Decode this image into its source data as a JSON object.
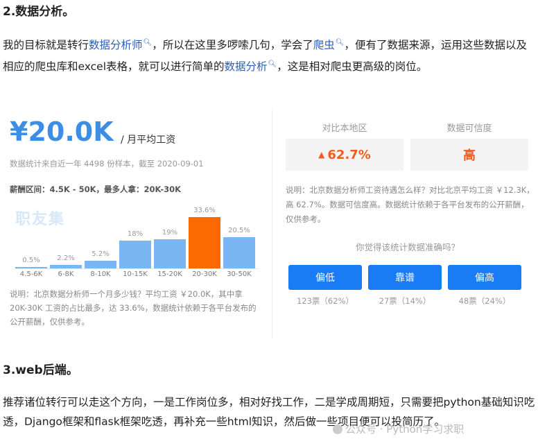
{
  "section2": {
    "title": "2.数据分析。",
    "p_part1": "我的目标就是转行",
    "p_link1": "数据分析师",
    "p_part2": "，所以在这里多啰嗦几句，学会了",
    "p_link2": "爬虫",
    "p_part3": "，便有了数据来源，运用这些数据以及相应的爬虫库和excel表格，就可以进行简单的",
    "p_link3": "数据分析",
    "p_part4": "，这是相对爬虫更高级的岗位。"
  },
  "salary_card": {
    "amount": "¥20.0K",
    "unit": "/ 月平均工资",
    "stats": "数据统计来自近一年 4498 份样本，截至 2020-09-01",
    "range": "薪酬区间：4.5K - 50K，最多人拿：20K-30K",
    "logo_text": "职友集",
    "note": "说明：北京数据分析师一个月多少钱？平均工资 ￥20.0K，其中拿 20K-30K 工资的占比最多，达 33.6%，数据统计依赖于各平台发布的公开薪酬，仅供参考。"
  },
  "chart_data": {
    "type": "bar",
    "categories": [
      "4.5-6K",
      "6-8K",
      "8-10K",
      "10-15K",
      "15-20K",
      "20-30K",
      "30-50K"
    ],
    "values": [
      0.5,
      2.2,
      5.2,
      18,
      19,
      33.6,
      20.5
    ],
    "labels": [
      "0.5%",
      "2.2%",
      "5.2%",
      "18%",
      "19%",
      "33.6%",
      "20.5%"
    ],
    "highlight_index": 5,
    "ylim": [
      0,
      33.6
    ],
    "bar_color": "#7ab7f2",
    "highlight_color": "#fb6a00"
  },
  "compare": {
    "local_label": "对比本地区",
    "local_value": "62.7%",
    "trust_label": "数据可信度",
    "trust_value": "高",
    "note": "说明：北京数据分析师工资待遇怎么样？对比北京平均工资 ￥12.3K，高 62.7%。数据可信度高。数据统计依赖于各平台发布的公开薪酬，仅供参考。",
    "question": "你觉得该统计数据准确吗？",
    "votes": [
      {
        "label": "偏低",
        "count": "123票（62%）"
      },
      {
        "label": "靠谱",
        "count": "27票（14%）"
      },
      {
        "label": "偏高",
        "count": "48票（24%）"
      }
    ],
    "accent": "#1a7cf4"
  },
  "section3": {
    "title": "3.web后端。",
    "p": "推荐诸位转行可以走这个方向，一是工作岗位多，相对好找工作，二是学成周期短，只需要把python基础知识吃透，Django框架和flask框架吃透，再补充一些html知识，然后做一些项目便可以投简历了。"
  },
  "watermark": "公众号 · Python学习求职"
}
